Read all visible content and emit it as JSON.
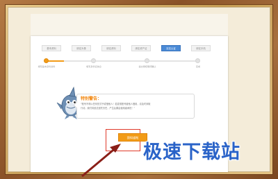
{
  "tabs": [
    {
      "label": "基本资料",
      "active": false
    },
    {
      "label": "绑定头像",
      "active": false
    },
    {
      "label": "绑定资料",
      "active": false
    },
    {
      "label": "绑定资产证",
      "active": false
    },
    {
      "label": "实名认证",
      "active": true
    },
    {
      "label": "绑定手机",
      "active": false
    }
  ],
  "steps": [
    {
      "label": "填写基本身份资料"
    },
    {
      "label": "填写身份证信息"
    },
    {
      "label": "提交审核等待确认"
    },
    {
      "label": "完成"
    }
  ],
  "progress": 0.12,
  "warning": {
    "title": "特别警告：",
    "text_line1": "“账号不得以任何形式予或借他人！若发现账号被他人借用，请及时采取",
    "text_line2": "行动，我们将依法追究责任，产生后果由使用者承担！”"
  },
  "confirm_button": "我知道啦",
  "watermark": "极速下载站",
  "colors": {
    "accent": "#f29b17",
    "highlight": "#e03a2a",
    "tab_active": "#4a8ad6",
    "watermark": "#2a63c8"
  }
}
